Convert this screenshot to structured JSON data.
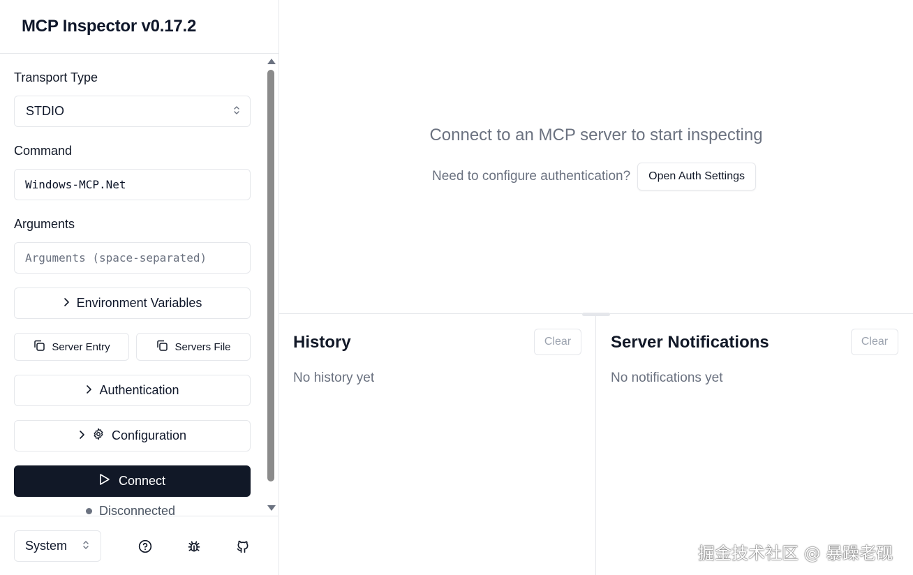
{
  "app": {
    "title": "MCP Inspector v0.17.2"
  },
  "sidebar": {
    "transport_label": "Transport Type",
    "transport_value": "STDIO",
    "command_label": "Command",
    "command_value": "Windows-MCP.Net",
    "arguments_label": "Arguments",
    "arguments_placeholder": "Arguments (space-separated)",
    "env_vars_label": "Environment Variables",
    "server_entry_label": "Server Entry",
    "servers_file_label": "Servers File",
    "authentication_label": "Authentication",
    "configuration_label": "Configuration",
    "connect_label": "Connect",
    "status_text": "Disconnected",
    "status_color": "#6b7280",
    "connect_color": "#111827"
  },
  "footer": {
    "theme_value": "System",
    "icons": [
      "help-icon",
      "bug-icon",
      "github-icon"
    ]
  },
  "main": {
    "connect_message": "Connect to an MCP server to start inspecting",
    "auth_prompt": "Need to configure authentication?",
    "auth_button": "Open Auth Settings"
  },
  "history": {
    "title": "History",
    "clear_label": "Clear",
    "empty_text": "No history yet"
  },
  "notifications": {
    "title": "Server Notifications",
    "clear_label": "Clear",
    "empty_text": "No notifications yet"
  },
  "watermark": "掘金技术社区 @ 暴躁老砚"
}
